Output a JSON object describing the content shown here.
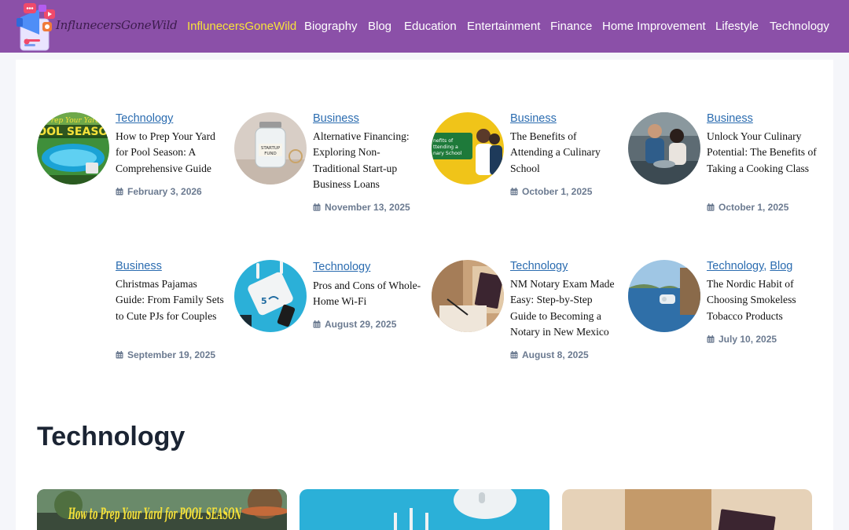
{
  "site": {
    "logo_text": "InflunecersGoneWild"
  },
  "nav": {
    "items": [
      {
        "label": "InflunecersGoneWild",
        "active": true
      },
      {
        "label": "Biography"
      },
      {
        "label": "Blog"
      },
      {
        "label": "Education"
      },
      {
        "label": "Entertainment"
      },
      {
        "label": "Finance"
      },
      {
        "label": "Home Improvement"
      },
      {
        "label": "Lifestyle"
      },
      {
        "label": "Technology"
      }
    ]
  },
  "posts": [
    {
      "cats": [
        "Technology"
      ],
      "title": "How to Prep Your Yard for Pool Season: A Comprehensive Guide",
      "date": "February 3, 2026",
      "thumb_text": "POOL SEASON"
    },
    {
      "cats": [
        "Business"
      ],
      "title": "Alternative Financing: Exploring Non-Traditional Start-up Business Loans",
      "date": "November 13, 2025",
      "thumb_text": "STARTUP FUND"
    },
    {
      "cats": [
        "Business"
      ],
      "title": "The Benefits of Attending a Culinary School",
      "date": "October 1, 2025",
      "thumb_text": "Benefits of Attending a Culinary School"
    },
    {
      "cats": [
        "Business"
      ],
      "title": "Unlock Your Culinary Potential: The Benefits of Taking a Cooking Class",
      "date": "October 1, 2025"
    },
    {
      "cats": [
        "Business"
      ],
      "title": "Christmas Pajamas Guide: From Family Sets to Cute PJs for Couples",
      "date": "September 19, 2025"
    },
    {
      "cats": [
        "Technology"
      ],
      "title": "Pros and Cons of Whole-Home Wi-Fi",
      "date": "August 29, 2025",
      "thumb_text": "5"
    },
    {
      "cats": [
        "Technology"
      ],
      "title": "NM Notary Exam Made Easy: Step-by-Step Guide to Becoming a Notary in New Mexico",
      "date": "August 8, 2025"
    },
    {
      "cats": [
        "Technology",
        "Blog"
      ],
      "title": "The Nordic Habit of Choosing Smokeless Tobacco Products",
      "date": "July 10, 2025"
    }
  ],
  "section": {
    "title": "Technology"
  },
  "cards": [
    {
      "text": "How to Prep Your Yard for POOL SEASON"
    },
    {
      "text": ""
    },
    {
      "text": ""
    }
  ],
  "colors": {
    "header": "#8b50a8",
    "active_nav": "#f7e33a",
    "link": "#2b6cb0",
    "date": "#6b7a90",
    "heading": "#1b2433"
  }
}
